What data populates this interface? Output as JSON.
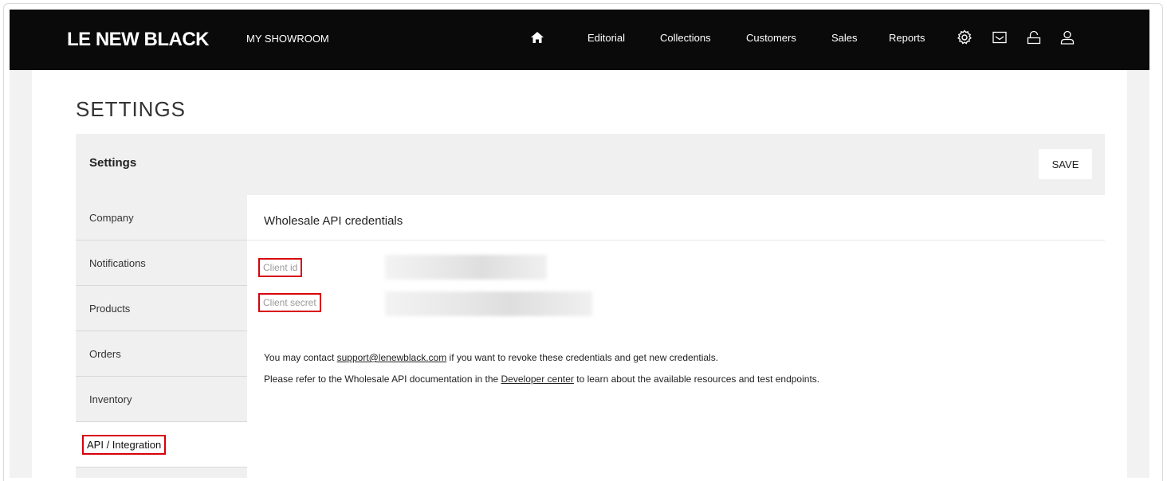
{
  "header": {
    "logo": "LE NEW BLACK",
    "section": "MY SHOWROOM",
    "nav": [
      "Editorial",
      "Collections",
      "Customers",
      "Sales",
      "Reports"
    ],
    "icons": [
      "home-icon",
      "settings-icon",
      "inbox-icon",
      "bag-icon",
      "user-icon"
    ]
  },
  "page": {
    "title": "SETTINGS"
  },
  "panel": {
    "title": "Settings",
    "save_label": "SAVE"
  },
  "sidebar": {
    "items": [
      {
        "label": "Company"
      },
      {
        "label": "Notifications"
      },
      {
        "label": "Products"
      },
      {
        "label": "Orders"
      },
      {
        "label": "Inventory"
      },
      {
        "label": "API / Integration",
        "active": true
      }
    ]
  },
  "content": {
    "title": "Wholesale API credentials",
    "client_id_label": "Client id",
    "client_secret_label": "Client secret",
    "note1": {
      "before": "You may contact ",
      "link": "support@lenewblack.com",
      "after": " if you want to revoke these credentials and get new credentials."
    },
    "note2": {
      "before": "Please refer to the Wholesale API documentation in the ",
      "link": "Developer center",
      "after": " to learn about the available resources and test endpoints."
    }
  },
  "colors": {
    "topbar": "#0a0a0a",
    "highlight": "#d8000c",
    "panel_bg": "#f0f0f0"
  }
}
